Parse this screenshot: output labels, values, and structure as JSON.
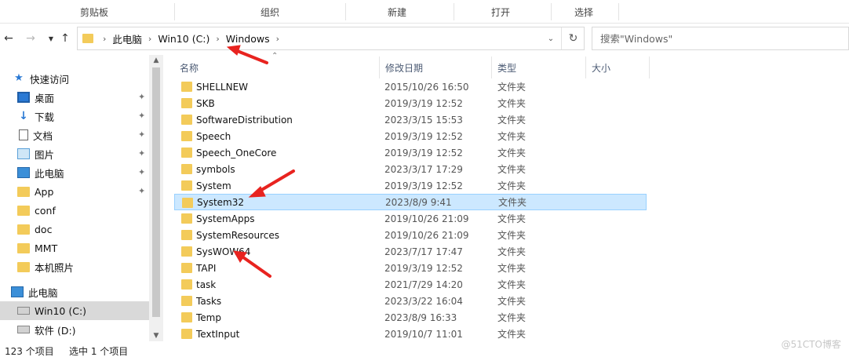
{
  "ribbon": {
    "groups": [
      "剪贴板",
      "组织",
      "新建",
      "打开",
      "选择"
    ]
  },
  "nav": {
    "back_icon": "back-arrow-icon",
    "forward_icon": "forward-arrow-icon",
    "recent_icon": "chevron-down-icon",
    "up_icon": "up-arrow-icon"
  },
  "address": {
    "crumbs": [
      "此电脑",
      "Win10 (C:)",
      "Windows"
    ]
  },
  "search": {
    "placeholder": "搜索\"Windows\""
  },
  "sidebar": {
    "items": [
      {
        "label": "快速访问",
        "icon": "star-icon"
      },
      {
        "label": "桌面",
        "icon": "desktop-icon",
        "pinned": true
      },
      {
        "label": "下载",
        "icon": "download-icon",
        "pinned": true
      },
      {
        "label": "文档",
        "icon": "document-icon",
        "pinned": true
      },
      {
        "label": "图片",
        "icon": "pictures-icon",
        "pinned": true
      },
      {
        "label": "此电脑",
        "icon": "computer-icon",
        "pinned": true
      },
      {
        "label": "App",
        "icon": "folder-icon",
        "pinned": true
      },
      {
        "label": "conf",
        "icon": "folder-icon"
      },
      {
        "label": "doc",
        "icon": "folder-icon"
      },
      {
        "label": "MMT",
        "icon": "folder-icon"
      },
      {
        "label": "本机照片",
        "icon": "folder-icon"
      },
      {
        "label": "此电脑",
        "icon": "computer-icon"
      },
      {
        "label": "Win10 (C:)",
        "icon": "drive-icon",
        "selected": true
      },
      {
        "label": "软件 (D:)",
        "icon": "drive-icon"
      }
    ]
  },
  "columns": {
    "name": "名称",
    "date": "修改日期",
    "type": "类型",
    "size": "大小"
  },
  "files": [
    {
      "name": "SHELLNEW",
      "date": "2015/10/26 16:50",
      "type": "文件夹"
    },
    {
      "name": "SKB",
      "date": "2019/3/19 12:52",
      "type": "文件夹"
    },
    {
      "name": "SoftwareDistribution",
      "date": "2023/3/15 15:53",
      "type": "文件夹"
    },
    {
      "name": "Speech",
      "date": "2019/3/19 12:52",
      "type": "文件夹"
    },
    {
      "name": "Speech_OneCore",
      "date": "2019/3/19 12:52",
      "type": "文件夹"
    },
    {
      "name": "symbols",
      "date": "2023/3/17 17:29",
      "type": "文件夹"
    },
    {
      "name": "System",
      "date": "2019/3/19 12:52",
      "type": "文件夹"
    },
    {
      "name": "System32",
      "date": "2023/8/9 9:41",
      "type": "文件夹",
      "selected": true
    },
    {
      "name": "SystemApps",
      "date": "2019/10/26 21:09",
      "type": "文件夹"
    },
    {
      "name": "SystemResources",
      "date": "2019/10/26 21:09",
      "type": "文件夹"
    },
    {
      "name": "SysWOW64",
      "date": "2023/7/17 17:47",
      "type": "文件夹"
    },
    {
      "name": "TAPI",
      "date": "2019/3/19 12:52",
      "type": "文件夹"
    },
    {
      "name": "task",
      "date": "2021/7/29 14:20",
      "type": "文件夹"
    },
    {
      "name": "Tasks",
      "date": "2023/3/22 16:04",
      "type": "文件夹"
    },
    {
      "name": "Temp",
      "date": "2023/8/9 16:33",
      "type": "文件夹"
    },
    {
      "name": "TextInput",
      "date": "2019/10/7 11:01",
      "type": "文件夹"
    }
  ],
  "status": {
    "count": "123 个项目",
    "selected": "选中 1 个项目"
  },
  "watermark": "@51CTO博客",
  "colors": {
    "selection": "#cce8ff",
    "folder": "#f3cb5a",
    "annotation_arrow": "#e8231f"
  }
}
